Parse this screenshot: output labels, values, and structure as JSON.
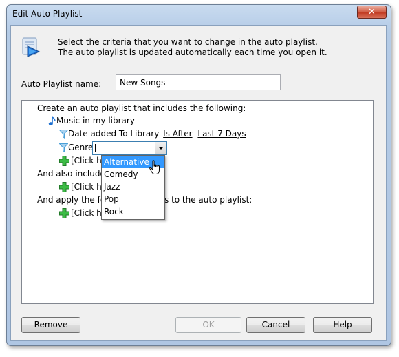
{
  "window": {
    "title": "Edit Auto Playlist",
    "close_symbol": "✕"
  },
  "header": {
    "line1": "Select the criteria that you want to change in the auto playlist.",
    "line2": "The auto playlist is updated automatically each time you open it."
  },
  "playlist_name": {
    "label": "Auto Playlist name:",
    "value": "New Songs"
  },
  "criteria": {
    "intro": "Create an auto playlist that includes the following:",
    "source": "Music in my library",
    "rule1": {
      "field": "Date added To Library",
      "operator": "Is After",
      "value": "Last 7 Days"
    },
    "rule2": {
      "field": "Genre",
      "operator": "Is"
    },
    "add_rule_1": "[Click he",
    "also_includes": "And also include",
    "add_rule_2": "[Click he",
    "apply_restrictions": "And apply the fol",
    "apply_restrictions_tail": "s to the auto playlist:",
    "add_rule_3": "[Click he"
  },
  "genre_options": [
    "Alternative",
    "Comedy",
    "Jazz",
    "Pop",
    "Rock"
  ],
  "genre_selected": "Alternative",
  "buttons": {
    "remove": "Remove",
    "ok": "OK",
    "cancel": "Cancel",
    "help": "Help"
  },
  "colors": {
    "selection": "#3399ff",
    "plus_green": "#2fa83a",
    "filter_blue": "#4aa0d8"
  }
}
